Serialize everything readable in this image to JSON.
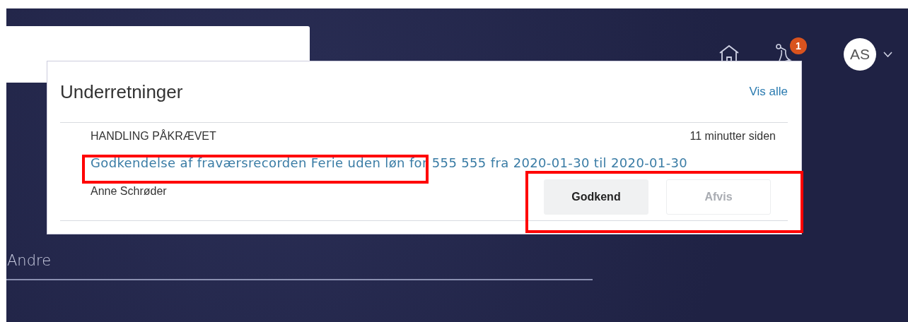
{
  "header": {
    "notification_count": "1",
    "avatar": "AS"
  },
  "notifications": {
    "title": "Underretninger",
    "view_all": "Vis alle",
    "items": [
      {
        "category": "HANDLING PÅKRÆVET",
        "time": "11 minutter siden",
        "link": "Godkendelse af fraværsrecorden Ferie uden løn for 555 555 fra 2020-01-30 til 2020-01-30",
        "sender": "Anne Schrøder",
        "actions": [
          {
            "label": "Godkend",
            "disabled": false
          },
          {
            "label": "Afvis",
            "disabled": true
          }
        ]
      }
    ]
  },
  "section": {
    "title": "Andre"
  }
}
